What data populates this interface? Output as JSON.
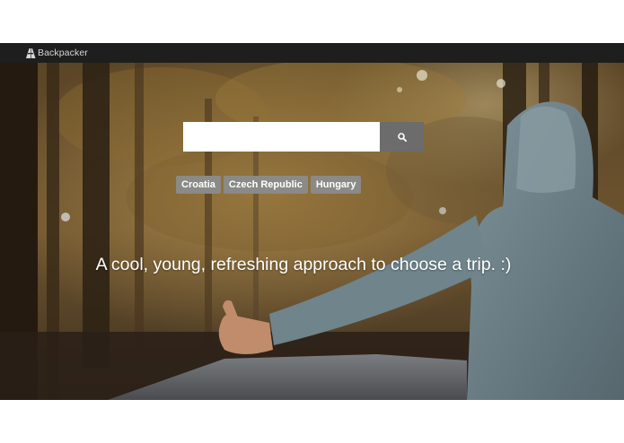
{
  "navbar": {
    "brand": "Backpacker",
    "logo_icon": "backpack-a-logo-icon",
    "background": "#1e1e1e"
  },
  "hero": {
    "search": {
      "value": "",
      "placeholder": "",
      "button_icon": "search-icon"
    },
    "tags": [
      {
        "label": "Croatia"
      },
      {
        "label": "Czech Republic"
      },
      {
        "label": "Hungary"
      }
    ],
    "tagline": "A cool, young, refreshing approach to choose a trip. :)"
  },
  "colors": {
    "search_button": "#6c6c6c",
    "tag_bg": "#8a8a86",
    "tagline": "#ffffff"
  }
}
